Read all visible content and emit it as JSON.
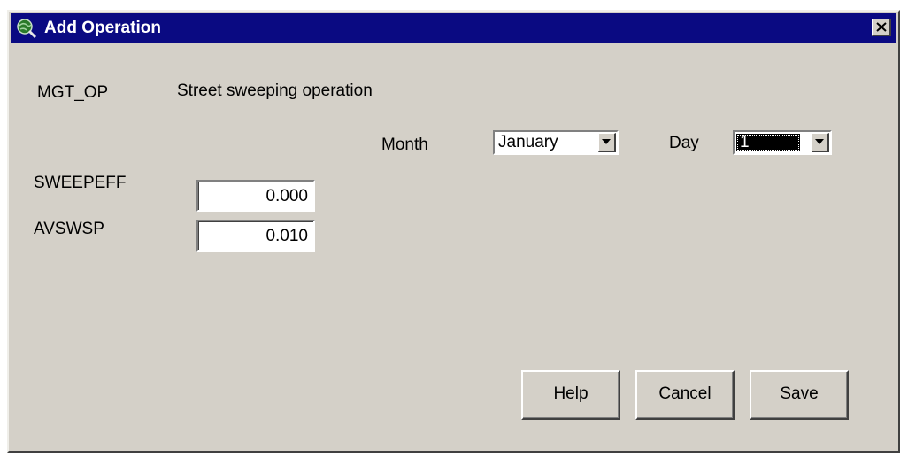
{
  "window": {
    "title": "Add Operation",
    "title_icon": "globe-magnifier-icon",
    "close_icon": "close-icon",
    "colors": {
      "titlebar": "#0a0a82",
      "face": "#d4d0c8"
    }
  },
  "operation": {
    "code_label": "MGT_OP",
    "description": "Street sweeping operation"
  },
  "schedule": {
    "month_label": "Month",
    "month_value": "January",
    "day_label": "Day",
    "day_value": "1"
  },
  "params": [
    {
      "label": "SWEEPEFF",
      "value": "0.000"
    },
    {
      "label": "AVSWSP",
      "value": "0.010"
    }
  ],
  "buttons": {
    "help": "Help",
    "cancel": "Cancel",
    "save": "Save"
  }
}
